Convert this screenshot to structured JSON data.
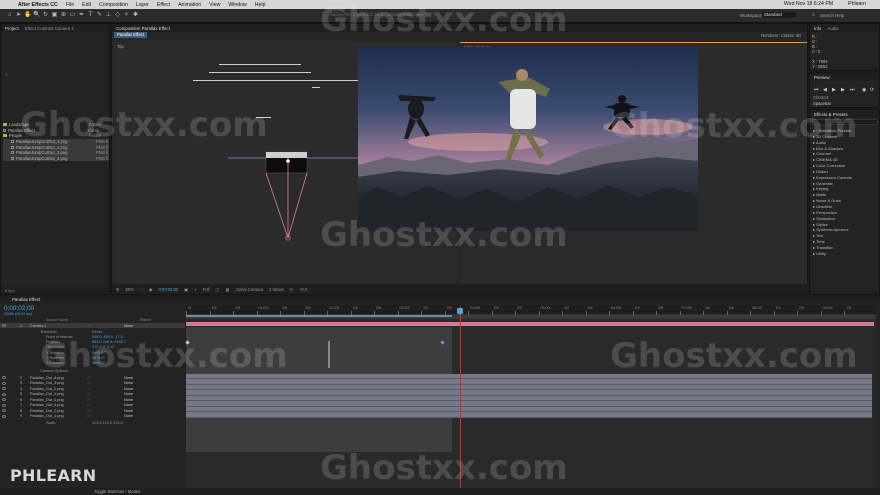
{
  "menubar": {
    "app": "After Effects CC",
    "items": [
      "File",
      "Edit",
      "Composition",
      "Layer",
      "Effect",
      "Animation",
      "View",
      "Window",
      "Help"
    ],
    "title": "Adobe After Effects CC 2015 - Untitled Project.aep *",
    "clock": "Wed Nov 18  6:24 PM",
    "user": "Phlearn"
  },
  "toolbar": {
    "workspace_label": "Workspace:",
    "workspace_value": "Standard",
    "search_help": "Search Help"
  },
  "project": {
    "tabs": [
      "Project",
      "Effect Controls Camera 1"
    ],
    "items": [
      {
        "name": "Landscape",
        "type": "Folder",
        "kind": "folder"
      },
      {
        "name": "Parallax Effect",
        "type": "Comp",
        "kind": "comp"
      },
      {
        "name": "People",
        "type": "Folder",
        "kind": "folder"
      },
      {
        "name": "ParallaxJumpCutOut_1.png",
        "type": "PNG fi",
        "kind": "file"
      },
      {
        "name": "ParallaxJumpCutOut_2.png",
        "type": "PNG fi",
        "kind": "file"
      },
      {
        "name": "ParallaxJumpCutOut_3.png",
        "type": "PNG fi",
        "kind": "file"
      },
      {
        "name": "ParallaxJumpCutOut_4.png",
        "type": "PNG fi",
        "kind": "file"
      }
    ],
    "footer": "8 bpc"
  },
  "composition": {
    "tab": "Composition Parallax Effect",
    "subtab": "Parallax Effect",
    "renderer": "Renderer:  Classic 3D",
    "left_view_label": "Top",
    "right_view_label": "Active Camera",
    "footer": {
      "zoom": "50%",
      "time": "0;00;02;00",
      "resolution": "Full",
      "camera": "Active Camera",
      "views": "2 Views",
      "exposure": "+0.0"
    }
  },
  "info": {
    "tabs": [
      "Info",
      "Audio"
    ],
    "text": "R :\nG :\nB :\nA : 0\n\nX : 7584\nY : 8552\n\nUndo\nTime Change"
  },
  "preview": {
    "tab": "Preview",
    "shortcut_label": "Shortcut",
    "shortcut_value": "Spacebar"
  },
  "effects": {
    "tab": "Effects & Presets",
    "items": [
      "* Animation Presets",
      "3D Channel",
      "Audio",
      "Blur & Sharpen",
      "Channel",
      "CINEMA 4D",
      "Color Correction",
      "Distort",
      "Expression Controls",
      "Generate",
      "Keying",
      "Matte",
      "Noise & Grain",
      "Obsolete",
      "Perspective",
      "Simulation",
      "Stylize",
      "Synthetic Aperture",
      "Text",
      "Time",
      "Transition",
      "Utility"
    ]
  },
  "timeline": {
    "tab": "Parallax Effect",
    "timecode": "0;00;02;00",
    "subcode": "00060 (29.97 fps)",
    "col_source": "Source Name",
    "col_parent": "Parent",
    "rows": [
      {
        "num": "1",
        "name": "Camera 1",
        "parent": "None",
        "kind": "layer"
      },
      {
        "num": "",
        "name": "Transform",
        "value": "Reset",
        "kind": "group"
      },
      {
        "num": "",
        "name": "Point of Interest",
        "value": "918.0, 620.0, 17.5",
        "kind": "prop"
      },
      {
        "num": "",
        "name": "Position",
        "value": "883.0,748.0,-3404.7",
        "kind": "prop"
      },
      {
        "num": "",
        "name": "Orientation",
        "value": "0.0°,0.0°,0.0°",
        "kind": "prop"
      },
      {
        "num": "",
        "name": "X Rotation",
        "value": "0x+0.0°",
        "kind": "prop"
      },
      {
        "num": "",
        "name": "Y Rotation",
        "value": "0x+0.0°",
        "kind": "prop"
      },
      {
        "num": "",
        "name": "Z Rotation",
        "value": "0x+0.0°",
        "kind": "prop"
      },
      {
        "num": "",
        "name": "Camera Options",
        "value": "",
        "kind": "group"
      },
      {
        "num": "2",
        "name": "Parallax_Out_4.png",
        "parent": "None",
        "kind": "layer"
      },
      {
        "num": "3",
        "name": "Parallax_Out_3.png",
        "parent": "None",
        "kind": "layer"
      },
      {
        "num": "4",
        "name": "Parallax_Out_2.png",
        "parent": "None",
        "kind": "layer"
      },
      {
        "num": "5",
        "name": "Parallax_Out_1.png",
        "parent": "None",
        "kind": "layer"
      },
      {
        "num": "6",
        "name": "Parallax_Out_4.png",
        "parent": "None",
        "kind": "layer"
      },
      {
        "num": "7",
        "name": "Parallax_Out_3.png",
        "parent": "None",
        "kind": "layer"
      },
      {
        "num": "8",
        "name": "Parallax_Out_2.png",
        "parent": "None",
        "kind": "layer"
      },
      {
        "num": "9",
        "name": "Parallax_Out_1.png",
        "parent": "None",
        "kind": "layer"
      },
      {
        "num": "",
        "name": "Scale",
        "value": "129.0,129.0,129.0",
        "kind": "prop"
      }
    ],
    "ruler_labels": [
      "0f",
      "10f",
      "20f",
      "01:00f",
      "10f",
      "20f",
      "02:00f",
      "10f",
      "20f",
      "03:00f",
      "10f",
      "20f",
      "04:00f",
      "10f",
      "20f",
      "05:00f",
      "10f",
      "20f",
      "06:00f",
      "10f",
      "20f",
      "07:00f",
      "10f",
      "20f",
      "08:00f",
      "10f",
      "20f",
      "09:00f",
      "10f"
    ],
    "footer": "Toggle Switches / Modes"
  },
  "branding": {
    "logo": "PHLEARN",
    "watermark": "Ghostxx.com"
  }
}
